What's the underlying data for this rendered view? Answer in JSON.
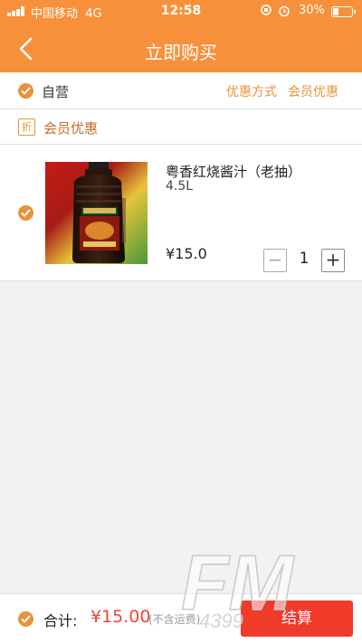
{
  "status_bar": {
    "carrier": "中国移动",
    "network": "4G",
    "time": "12:58",
    "battery": "30%",
    "battery_level": 0.3
  },
  "nav": {
    "title": "立即购买",
    "back_icon": "chevron-left-icon"
  },
  "store": {
    "name": "自营",
    "promo_link": "优惠方式",
    "member_link": "会员优惠"
  },
  "discount": {
    "badge": "折",
    "label": "会员优惠"
  },
  "product": {
    "name": "粤香红烧酱汁（老抽）",
    "spec": "4.5L",
    "price": "¥15.0",
    "quantity": "1",
    "image_icon": "soy-sauce-bottle-image"
  },
  "footer": {
    "total_label": "合计:",
    "total_value": "¥15.00",
    "shipping_note": "(不含运费)",
    "checkout_label": "结算"
  },
  "watermark": {
    "text": "FM",
    "subtext": "4399"
  },
  "colors": {
    "header": "#f7903a",
    "accent": "#e8923a",
    "checkout": "#f03a2a",
    "price_red": "#e8473a"
  }
}
